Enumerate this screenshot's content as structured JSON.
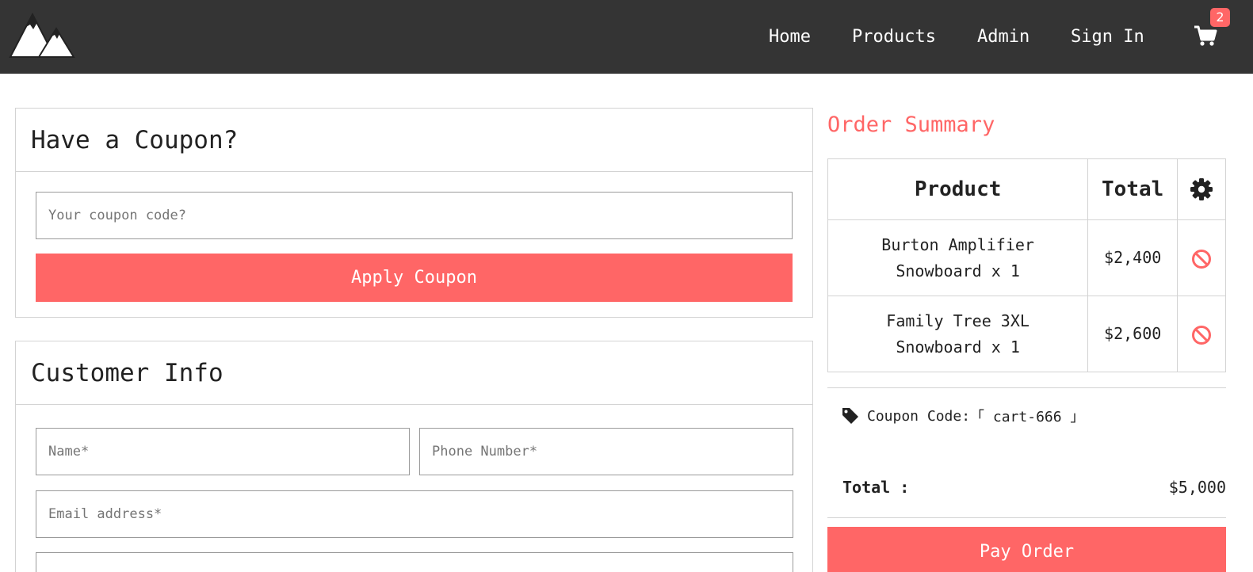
{
  "nav": {
    "links": [
      "Home",
      "Products",
      "Admin",
      "Sign In"
    ],
    "cart_count": "2"
  },
  "coupon_card": {
    "title": "Have a Coupon?",
    "input_placeholder": "Your coupon code?",
    "apply_label": "Apply Coupon"
  },
  "customer_card": {
    "title": "Customer Info",
    "name_placeholder": "Name*",
    "phone_placeholder": "Phone Number*",
    "email_placeholder": "Email address*"
  },
  "summary": {
    "title": "Order Summary",
    "headers": {
      "product": "Product",
      "total": "Total",
      "settings_icon": "gear-icon"
    },
    "rows": [
      {
        "product_line1": "Burton Amplifier",
        "product_line2": "Snowboard x 1",
        "total": "$2,400",
        "action_icon": "ban-icon"
      },
      {
        "product_line1": "Family Tree 3XL",
        "product_line2": "Snowboard x 1",
        "total": "$2,600",
        "action_icon": "ban-icon"
      }
    ],
    "coupon_label": "Coupon Code:",
    "coupon_code": "「 cart-666 」",
    "total_label": "Total :",
    "total_value": "$5,000",
    "pay_label": "Pay Order"
  },
  "colors": {
    "accent": "#ff6666",
    "navbar": "#343434",
    "border": "#d3d3d3"
  }
}
